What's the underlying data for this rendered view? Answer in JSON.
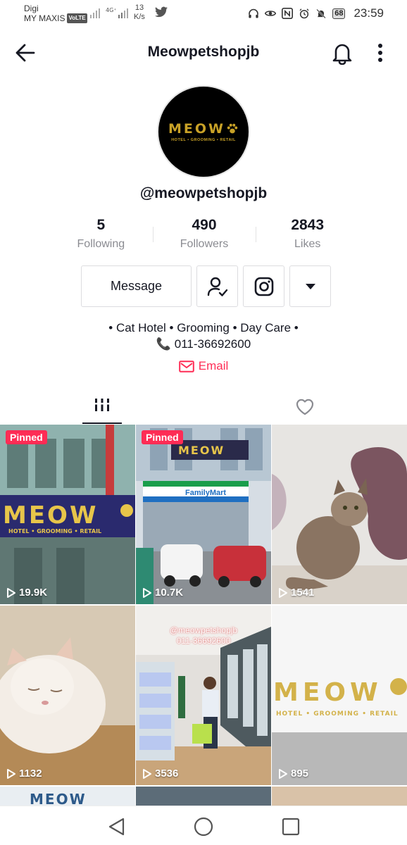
{
  "status_bar": {
    "carrier1": "Digi",
    "carrier2": "MY MAXIS",
    "volte": "VoLTE",
    "network": "4G⁺",
    "speed_value": "13",
    "speed_unit": "K/s",
    "battery": "68",
    "time": "23:59"
  },
  "header": {
    "title": "Meowpetshopjb"
  },
  "profile": {
    "logo_text": "MEOW",
    "logo_subtitle": "HOTEL • GROOMING • RETAIL",
    "handle": "@meowpetshopjb",
    "stats": [
      {
        "value": "5",
        "label": "Following"
      },
      {
        "value": "490",
        "label": "Followers"
      },
      {
        "value": "2843",
        "label": "Likes"
      }
    ],
    "message_label": "Message",
    "bio_line1": "• Cat Hotel • Grooming • Day Care •",
    "bio_phone": "011-36692600",
    "email_label": "Email"
  },
  "videos": [
    {
      "views": "19.9K",
      "pinned": "Pinned",
      "scene": "storefront-sign"
    },
    {
      "views": "10.7K",
      "pinned": "Pinned",
      "scene": "shop-building"
    },
    {
      "views": "1541",
      "scene": "tabby-cat"
    },
    {
      "views": "1132",
      "scene": "white-cat"
    },
    {
      "views": "3536",
      "scene": "shop-interior",
      "overlay1": "@meowpetshopjb",
      "overlay2": "011-36692600"
    },
    {
      "views": "895",
      "scene": "logo-wall"
    }
  ],
  "colors": {
    "accent": "#fe2c55",
    "logo_gold": "#c9a227",
    "text": "#161823",
    "muted": "#8a8b91"
  }
}
